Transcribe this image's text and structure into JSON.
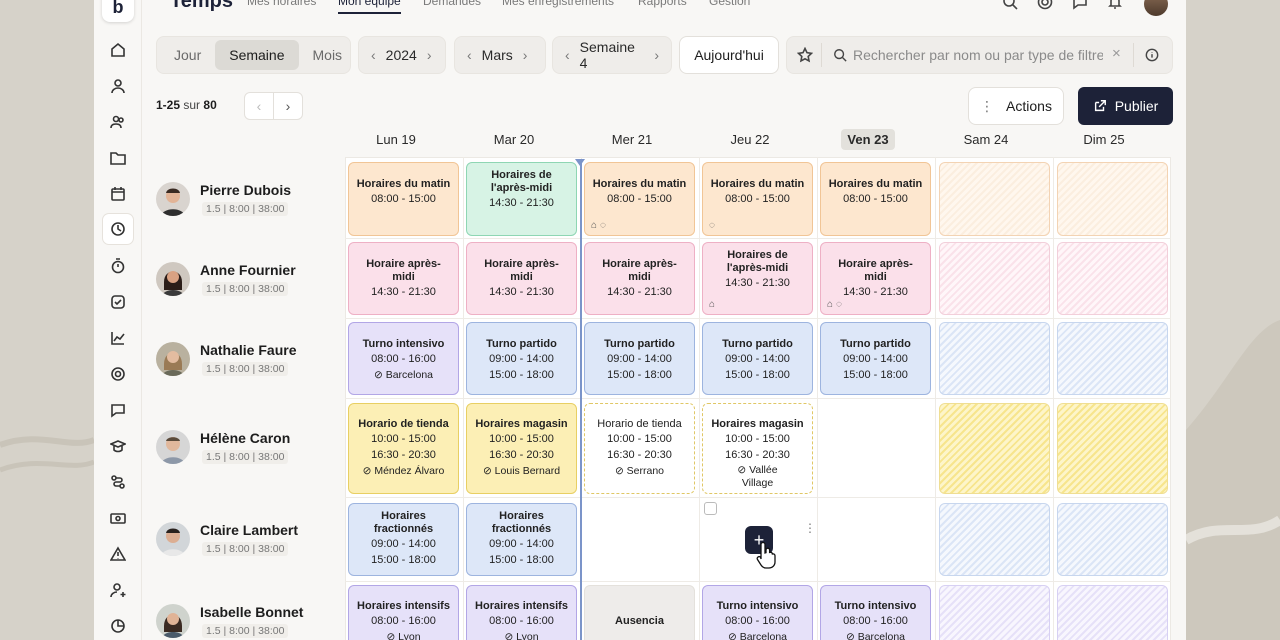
{
  "brand": "Temps",
  "topnav": [
    {
      "label": "Mes horaires",
      "active": false
    },
    {
      "label": "Mon équipe",
      "active": true
    },
    {
      "label": "Demandes",
      "active": false
    },
    {
      "label": "Mes enregistrements",
      "active": false
    },
    {
      "label": "Rapports",
      "active": false
    },
    {
      "label": "Gestion",
      "active": false
    }
  ],
  "view_switch": {
    "day": "Jour",
    "week": "Semaine",
    "month": "Mois",
    "selected": "Semaine"
  },
  "year": "2024",
  "month": "Mars",
  "week": "Semaine 4",
  "today_label": "Aujourd'hui",
  "search": {
    "placeholder": "Rechercher par nom ou par type de filtre..."
  },
  "pager": {
    "range": "1-25",
    "sur": "sur",
    "total": "80"
  },
  "actions_label": "Actions",
  "publish_label": "Publier",
  "days": [
    {
      "label": "Lun 19",
      "today": false
    },
    {
      "label": "Mar 20",
      "today": false
    },
    {
      "label": "Mer 21",
      "today": false
    },
    {
      "label": "Jeu 22",
      "today": false
    },
    {
      "label": "Ven 23",
      "today": true
    },
    {
      "label": "Sam 24",
      "today": false
    },
    {
      "label": "Dim 25",
      "today": false
    }
  ],
  "employees": [
    {
      "name": "Pierre Dubois",
      "meta": "1.5 | 8:00 | 38:00"
    },
    {
      "name": "Anne Fournier",
      "meta": "1.5 | 8:00 | 38:00"
    },
    {
      "name": "Nathalie Faure",
      "meta": "1.5 | 8:00 | 38:00"
    },
    {
      "name": "Hélène Caron",
      "meta": "1.5 | 8:00 | 38:00"
    },
    {
      "name": "Claire Lambert",
      "meta": "1.5 | 8:00 | 38:00"
    },
    {
      "name": "Isabelle Bonnet",
      "meta": "1.5 | 8:00 | 38:00"
    }
  ],
  "shifts": {
    "r0": [
      {
        "title": "Horaires du matin",
        "h1": "08:00 - 15:00"
      },
      {
        "title": "Horaires de l'après-midi",
        "h1": "14:30 - 21:30"
      },
      {
        "title": "Horaires du matin",
        "h1": "08:00 - 15:00"
      },
      {
        "title": "Horaires du matin",
        "h1": "08:00 - 15:00"
      },
      {
        "title": "Horaires du matin",
        "h1": "08:00 - 15:00"
      }
    ],
    "r1": [
      {
        "title": "Horaire après-midi",
        "h1": "14:30 - 21:30"
      },
      {
        "title": "Horaire après-midi",
        "h1": "14:30 - 21:30"
      },
      {
        "title": "Horaire après-midi",
        "h1": "14:30 - 21:30"
      },
      {
        "title": "Horaires de l'après-midi",
        "h1": "14:30 - 21:30"
      },
      {
        "title": "Horaire après-midi",
        "h1": "14:30 - 21:30"
      }
    ],
    "r2": [
      {
        "title": "Turno intensivo",
        "h1": "08:00 - 16:00",
        "loc": "Barcelona"
      },
      {
        "title": "Turno partido",
        "h1": "09:00 - 14:00",
        "h2": "15:00 - 18:00"
      },
      {
        "title": "Turno partido",
        "h1": "09:00 - 14:00",
        "h2": "15:00 - 18:00"
      },
      {
        "title": "Turno partido",
        "h1": "09:00 - 14:00",
        "h2": "15:00 - 18:00"
      },
      {
        "title": "Turno partido",
        "h1": "09:00 - 14:00",
        "h2": "15:00 - 18:00"
      }
    ],
    "r3": [
      {
        "title": "Horario de tienda",
        "h1": "10:00 - 15:00",
        "h2": "16:30 - 20:30",
        "loc": "Méndez Álvaro"
      },
      {
        "title": "Horaires magasin",
        "h1": "10:00 - 15:00",
        "h2": "16:30 - 20:30",
        "loc": "Louis Bernard"
      },
      {
        "title": "Horario de tienda",
        "h1": "10:00 - 15:00",
        "h2": "16:30 - 20:30",
        "loc": "Serrano"
      },
      {
        "title": "Horaires magasin",
        "h1": "10:00 - 15:00",
        "h2": "16:30 - 20:30",
        "loc": "Vallée Village"
      }
    ],
    "r4": [
      {
        "title": "Horaires fractionnés",
        "h1": "09:00 - 14:00",
        "h2": "15:00 - 18:00"
      },
      {
        "title": "Horaires fractionnés",
        "h1": "09:00 - 14:00",
        "h2": "15:00 - 18:00"
      }
    ],
    "r5": [
      {
        "title": "Horaires intensifs",
        "h1": "08:00 - 16:00",
        "loc": "Lyon"
      },
      {
        "title": "Horaires intensifs",
        "h1": "08:00 - 16:00",
        "loc": "Lyon"
      },
      {
        "title": "Ausencia"
      },
      {
        "title": "Turno intensivo",
        "h1": "08:00 - 16:00",
        "loc": "Barcelona"
      },
      {
        "title": "Turno intensivo",
        "h1": "08:00 - 16:00",
        "loc": "Barcelona"
      }
    ]
  },
  "add_symbol": "+",
  "colors": {
    "primary": "#1d2238",
    "now_line": "#7b94c9"
  }
}
